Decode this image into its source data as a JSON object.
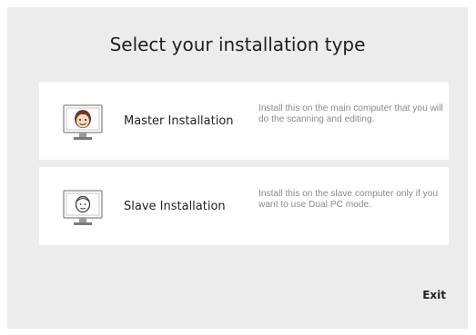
{
  "title": "Select your installation type",
  "options": [
    {
      "label": "Master Installation",
      "description": "Install this on the main computer that you will do the scanning and editing.",
      "icon": "master-computer-icon"
    },
    {
      "label": "Slave Installation",
      "description": "Install this on the slave computer only if you want to use Dual PC mode.",
      "icon": "slave-computer-icon"
    }
  ],
  "exit_label": "Exit",
  "colors": {
    "background": "#ececec",
    "card": "#ffffff",
    "description_text": "#8a8a8a",
    "hair": "#6b3a1f",
    "face": "#f6d9bf"
  }
}
